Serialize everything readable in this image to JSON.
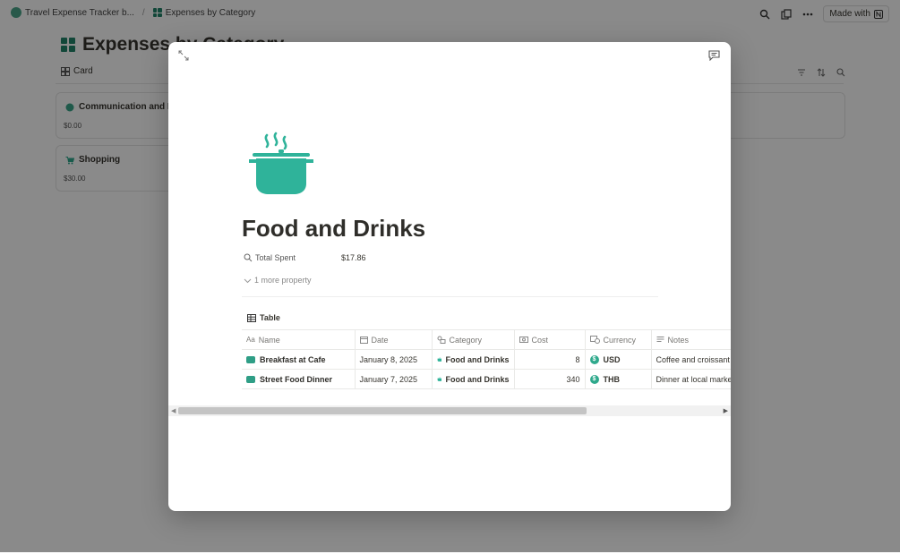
{
  "breadcrumb": {
    "workspace": "Travel Expense Tracker b...",
    "separator": "/",
    "database": "Expenses by Category"
  },
  "topbar": {
    "made_with": "Made with"
  },
  "database": {
    "title": "Expenses by Category",
    "view_label": "Card",
    "cards": [
      {
        "title": "Communication and Inte",
        "value": "$0.00"
      },
      {
        "title": "Shopping",
        "value": "$30.00"
      }
    ]
  },
  "modal": {
    "page_title": "Food and Drinks",
    "properties": [
      {
        "label": "Total Spent",
        "value": "$17.86"
      }
    ],
    "more_property": "1 more property",
    "table_label": "Table",
    "columns": [
      "Name",
      "Date",
      "Category",
      "Cost",
      "Currency",
      "Notes"
    ],
    "rows": [
      {
        "name": "Breakfast at Cafe",
        "date": "January 8, 2025",
        "category": "Food and Drinks",
        "cost": "8",
        "currency": "USD",
        "notes": "Coffee and croissant"
      },
      {
        "name": "Street Food Dinner",
        "date": "January 7, 2025",
        "category": "Food and Drinks",
        "cost": "340",
        "currency": "THB",
        "notes": "Dinner at local marke"
      }
    ]
  },
  "colors": {
    "accent": "#2fb39a",
    "icon_green": "#22836a",
    "overlay": "#757575"
  },
  "icons": [
    "expand-icon",
    "comment-icon",
    "cooking-pot-icon",
    "search-icon",
    "duplicate-icon",
    "more-icon"
  ]
}
